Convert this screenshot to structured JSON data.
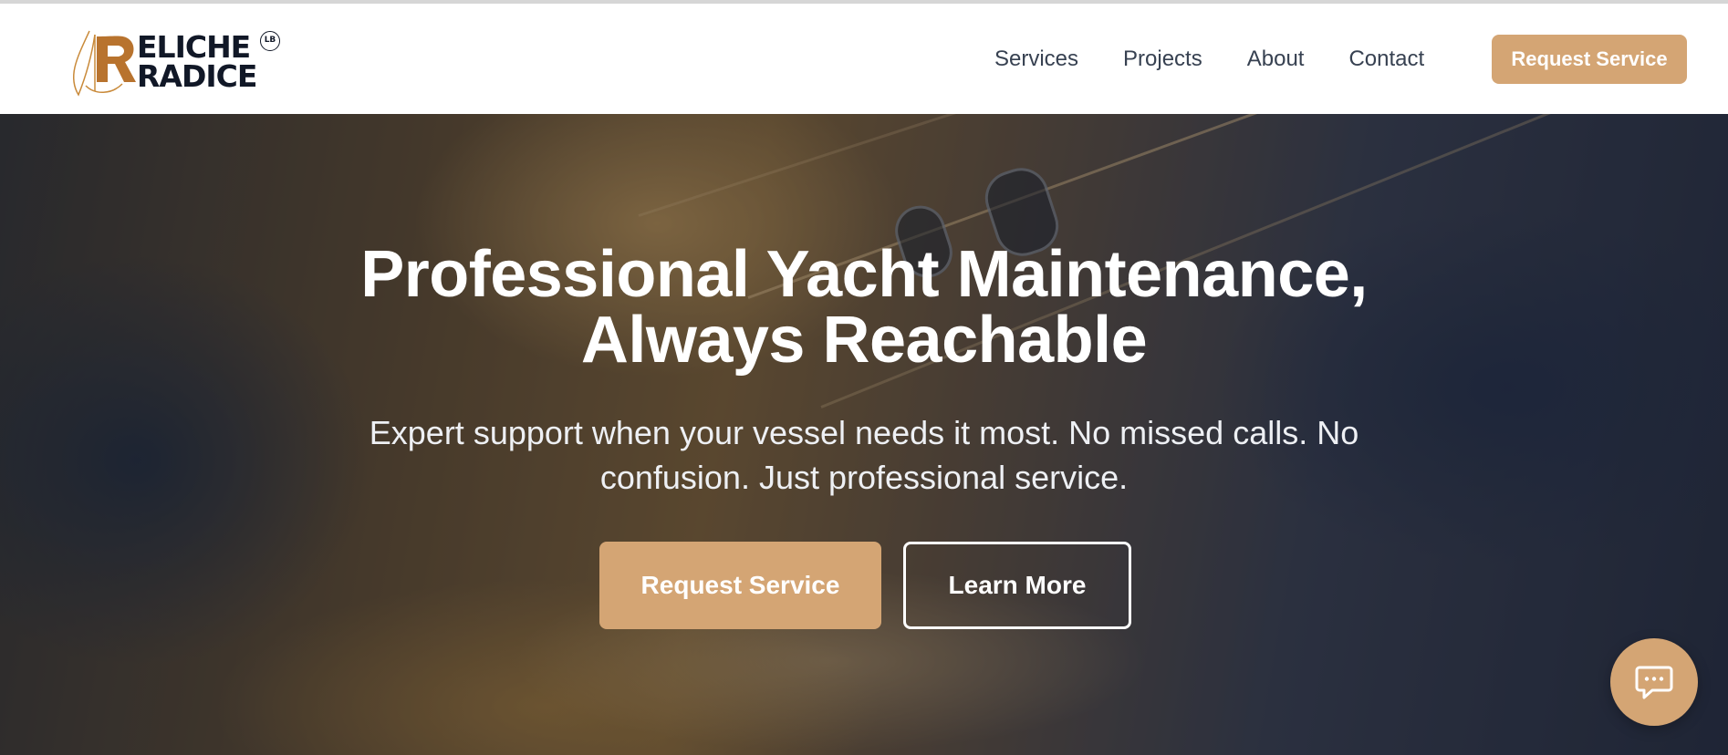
{
  "brand": {
    "line1": "ELICHE",
    "line2": "RADICE",
    "badge": "LB"
  },
  "nav": {
    "items": [
      {
        "label": "Services"
      },
      {
        "label": "Projects"
      },
      {
        "label": "About"
      },
      {
        "label": "Contact"
      }
    ],
    "cta_label": "Request Service"
  },
  "hero": {
    "title_line1": "Professional Yacht Maintenance,",
    "title_line2": "Always Reachable",
    "subtitle": "Expert support when your vessel needs it most. No missed calls. No confusion. Just professional service.",
    "primary_button": "Request Service",
    "secondary_button": "Learn More"
  },
  "chat": {
    "icon": "chat-bubble-icon"
  },
  "colors": {
    "accent": "#d4a574",
    "nav_text": "#374151",
    "logo_text": "#111827",
    "hero_text": "#ffffff"
  }
}
